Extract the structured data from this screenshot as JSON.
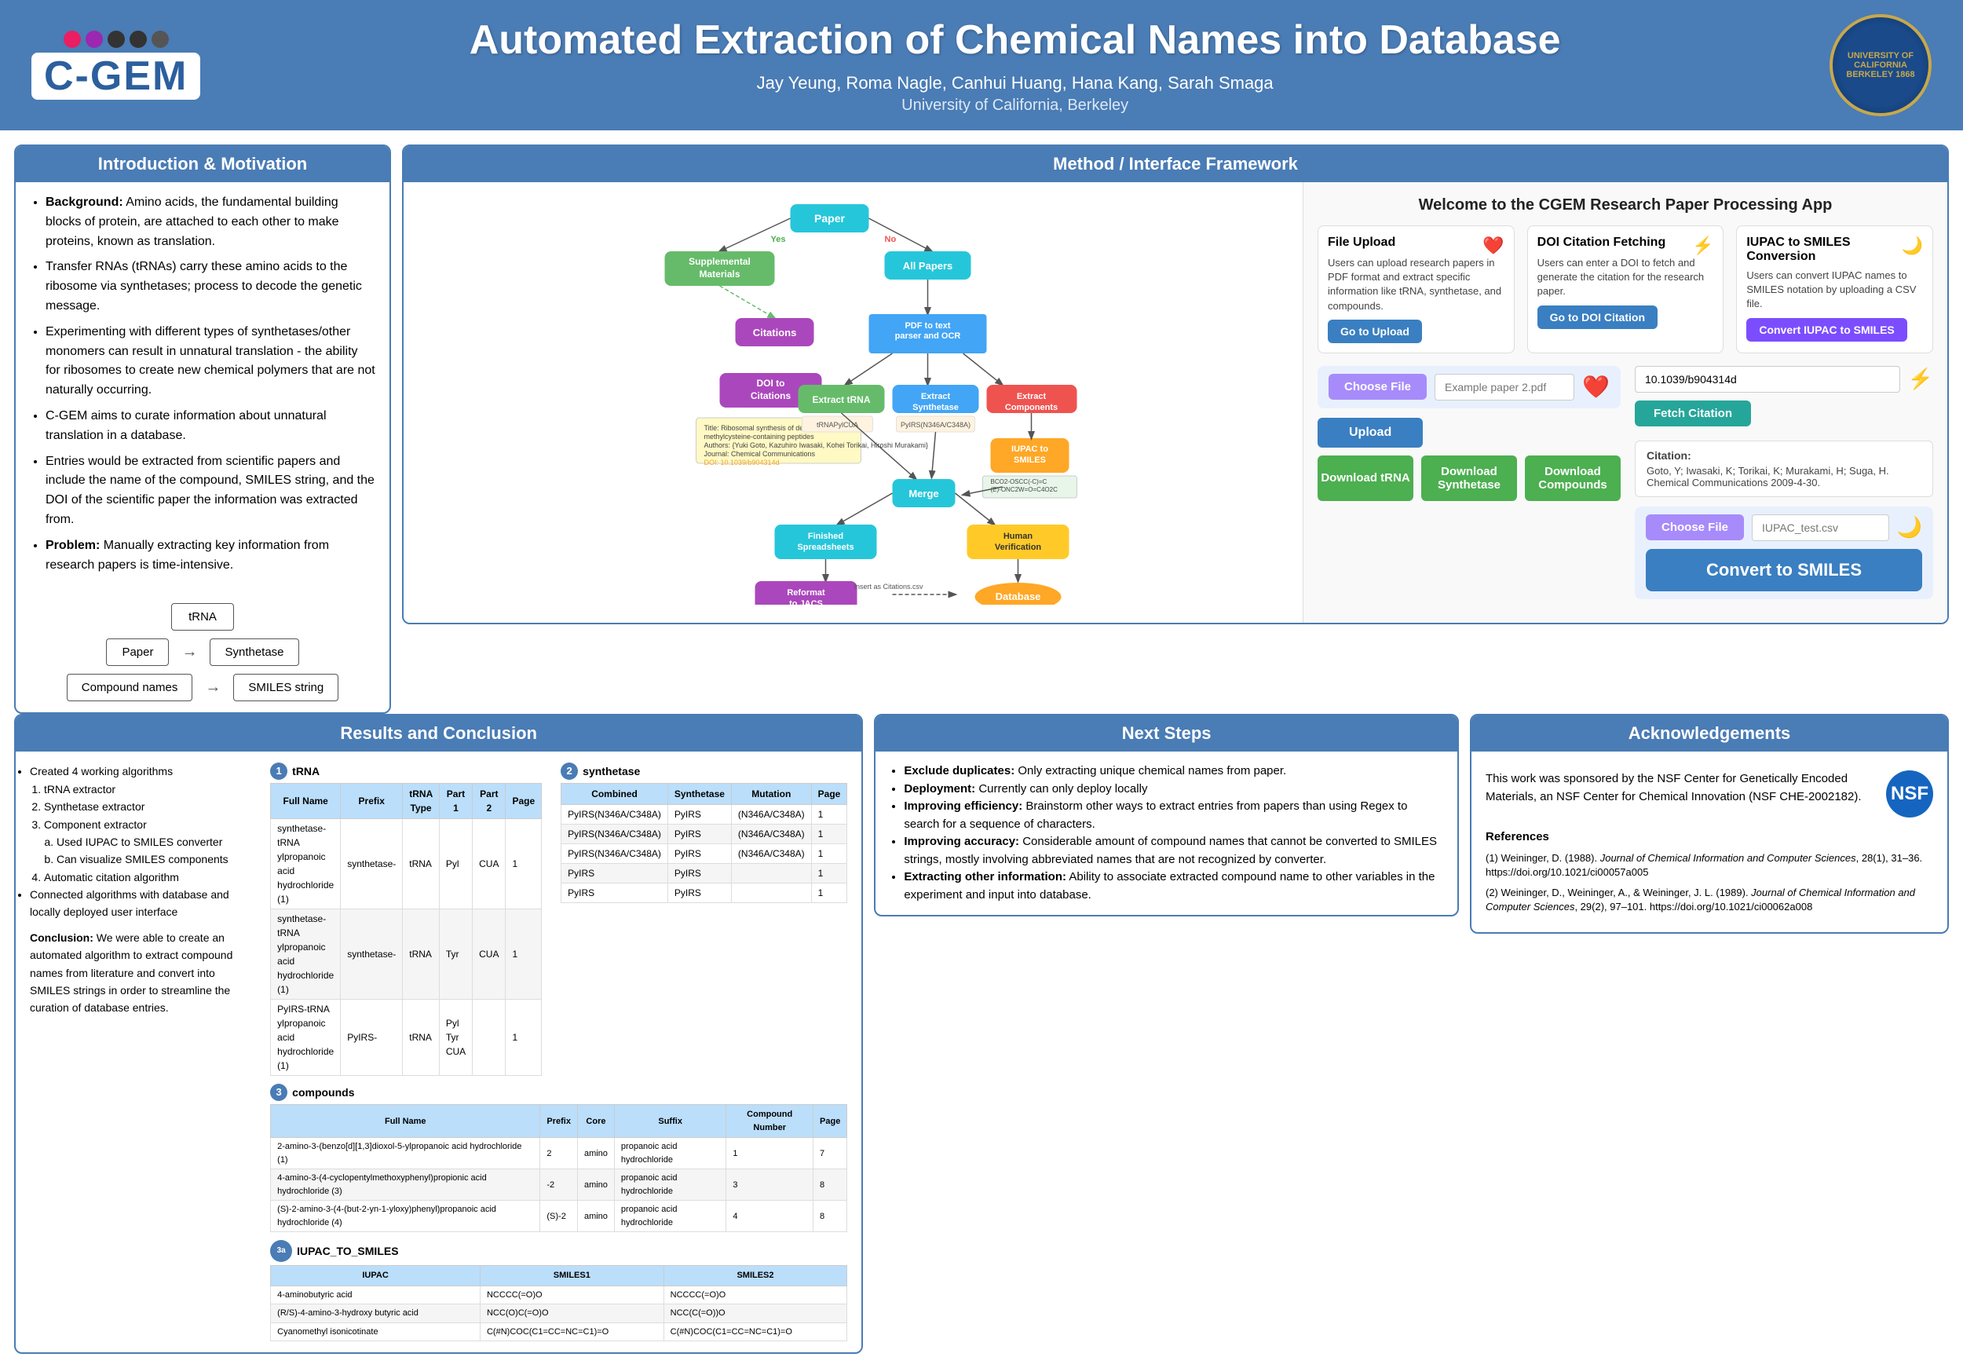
{
  "header": {
    "title": "Automated Extraction of Chemical Names into Database",
    "authors": "Jay Yeung, Roma Nagle, Canhui Huang, Hana Kang, Sarah Smaga",
    "institution": "University of California, Berkeley",
    "logo_text": "C-GEM",
    "seal_text": "UNIVERSITY OF CALIFORNIA BERKELEY 1868"
  },
  "intro": {
    "title": "Introduction & Motivation",
    "bullets": [
      {
        "bold": "Background:",
        "text": " Amino acids, the fundamental building blocks of protein, are attached to each other to make proteins, known as translation."
      },
      {
        "bold": "",
        "text": "Transfer RNAs (tRNAs) carry these amino acids to the ribosome via synthetases; process to decode the genetic message."
      },
      {
        "bold": "",
        "text": "Experimenting with different types of synthetases/other monomers can result in unnatural translation - the ability for ribosomes to create new chemical polymers that are not naturally occurring."
      },
      {
        "bold": "",
        "text": "C-GEM aims to curate information about unnatural translation in a database."
      },
      {
        "bold": "",
        "text": "Entries would be extracted from scientific papers and include the name of the compound, SMILES string, and the DOI of the scientific paper the information was extracted from."
      },
      {
        "bold": "Problem:",
        "text": " Manually extracting key information from research papers is time-intensive."
      }
    ],
    "diagram": {
      "row1": "tRNA",
      "row2_left": "Paper",
      "row2_right": "Synthetase",
      "row3_left": "Compound names",
      "row3_right": "SMILES string"
    }
  },
  "method": {
    "title": "Method / Interface Framework",
    "flowchart": {
      "nodes": [
        "Paper",
        "Supplemental Materials",
        "All Papers",
        "Citations",
        "DOI to Citations",
        "PDF to text parser and OCR",
        "Extract tRNA",
        "Extract Synthetase",
        "Extract Components",
        "IUPAC to SMILES",
        "Merge",
        "Finished Spreadsheets",
        "Human Verification",
        "Reformat to JACS",
        "Database"
      ]
    },
    "app": {
      "title": "Welcome to the CGEM Research Paper Processing App",
      "features": [
        {
          "title": "File Upload",
          "icon": "❤️",
          "desc": "Users can upload research papers in PDF format and extract specific information like tRNA, synthetase, and compounds.",
          "btn": "Go to Upload"
        },
        {
          "title": "DOI Citation Fetching",
          "icon": "⚡",
          "desc": "Users can enter a DOI to fetch and generate the citation for the research paper.",
          "btn": "Go to DOI Citation"
        },
        {
          "title": "IUPAC to SMILES Conversion",
          "icon": "🌙",
          "desc": "Users can convert IUPAC names to SMILES notation by uploading a CSV file.",
          "btn": "Convert IUPAC to SMILES"
        }
      ],
      "file_upload": {
        "choose_btn": "Choose File",
        "placeholder": "Example paper 2.pdf",
        "upload_btn": "Upload",
        "download_trna": "Download tRNA",
        "download_synthetase": "Download Synthetase",
        "download_compounds": "Download Compounds"
      },
      "doi": {
        "value": "10.1039/b904314d",
        "fetch_btn": "Fetch Citation",
        "citation_label": "Citation:",
        "citation_text": "Goto, Y; Iwasaki, K; Torikai, K; Murakami, H; Suga, H. Chemical Communications 2009-4-30."
      },
      "smiles": {
        "choose_btn": "Choose File",
        "filename": "IUPAC_test.csv",
        "convert_btn": "Convert to SMILES"
      }
    }
  },
  "results": {
    "title": "Results and Conclusion",
    "bullets": [
      "Created 4 working algorithms",
      "tRNA extractor",
      "Synthetase extractor",
      "Component extractor",
      "Used IUPAC to SMILES converter",
      "Can visualize SMILES components",
      "Automatic citation algorithm",
      "Connected algorithms with database and locally deployed user interface"
    ],
    "conclusion": {
      "title": "Conclusion:",
      "text": " We were able to create an automated algorithm to extract compound names from literature and convert into SMILES strings in order to streamline the curation of database entries."
    },
    "table1": {
      "label": "1  tRNA",
      "headers": [
        "Full Name",
        "Prefix",
        "tRNA Type",
        "Part 1",
        "Part 2",
        "Page"
      ],
      "rows": [
        [
          "synthetase-tRNA ylpropanoic acid hydrochloride (1)",
          "synthetase-",
          "tRNA",
          "Pyl",
          "CUA",
          "1"
        ],
        [
          "synthetase-tRNA ylpropanoic acid hydrochloride (1)",
          "synthetase-",
          "tRNA",
          "Tyr",
          "CUA",
          "1"
        ],
        [
          "PyIRS-tRNA ylpropanoic acid hydrochloride (1)",
          "PyIRS-",
          "tRNA",
          "Pyl\nTyr\nCUA",
          "",
          "1"
        ]
      ]
    },
    "table2": {
      "label": "2  synthetase",
      "headers": [
        "Combined",
        "Synthetase",
        "Mutation",
        "Page"
      ],
      "rows": [
        [
          "PyIRS(N346A/C348A)",
          "PyIRS",
          "(N346A/C348A)",
          "1"
        ],
        [
          "PyIRS(N346A/C348A)",
          "PyIRS",
          "(N346A/C348A)",
          "1"
        ],
        [
          "PyIRS(N346A/C348A)",
          "PyIRS",
          "(N346A/C348A)",
          "1"
        ],
        [
          "PyIRS",
          "PyIRS",
          "",
          "1"
        ],
        [
          "PyIRS",
          "PyIRS",
          "",
          "1"
        ]
      ]
    },
    "table3": {
      "label": "3  compounds",
      "headers": [
        "Full Name",
        "Prefix",
        "Core",
        "Suffix",
        "Compound Number",
        "Page"
      ],
      "rows": [
        [
          "2-amino-3-(benzo[d][1,3]dioxol-5-ylpropanoic acid hydrochloride (1)",
          "2",
          "amino",
          "propanoic acid hydrochloride",
          "1",
          "7"
        ],
        [
          "4-amino-3-(4-cyclopentylmethoxyphenyl)propionic acid hydrochloride (3)",
          "-2",
          "amino",
          "propanoic acid hydrochloride",
          "3",
          "8"
        ],
        [
          "(S)-2-amino-3-(4-(but-2-yn-1-yloxy)phenyl)propanoic acid hydrochloride (4)",
          "(S)-2",
          "amino",
          "propanoic acid hydrochloride",
          "4",
          "8"
        ]
      ]
    },
    "table3a": {
      "label": "3a  IUPAC_TO_SMILES",
      "headers": [
        "IUPAC",
        "SMILES1",
        "SMILES2"
      ],
      "rows": [
        [
          "4-aminobutyric acid",
          "NCCCC(=O)O",
          "NCCCC(=O)O"
        ],
        [
          "(R/S)-4-amino-3-hydroxy butyric acid",
          "NCC(O)C(=O)O",
          "NCC(C(=O))O"
        ],
        [
          "Cyanomethyl isonicotinate",
          "C(#N)COC(C1=CC=NC=C1)=O",
          "C(#N)COC(C1=CC=NC=C1)=O"
        ]
      ]
    }
  },
  "nextsteps": {
    "title": "Next Steps",
    "bullets": [
      {
        "bold": "Exclude duplicates:",
        "text": " Only extracting unique chemical names from paper."
      },
      {
        "bold": "Deployment:",
        "text": " Currently can only deploy locally"
      },
      {
        "bold": "Improving efficiency:",
        "text": " Brainstorm other ways to extract entries from papers than using Regex to search for a sequence of characters."
      },
      {
        "bold": "Improving accuracy:",
        "text": " Considerable amount of compound names that cannot be converted to SMILES strings, mostly involving abbreviated names that are not recognized by converter."
      },
      {
        "bold": "Extracting other information:",
        "text": " Ability to associate extracted compound name to other variables in the experiment and input into database."
      }
    ]
  },
  "acknowledgements": {
    "title": "Acknowledgements",
    "text": "This work was sponsored by the NSF Center for Genetically Encoded Materials, an NSF Center for Chemical Innovation (NSF CHE-2002182).",
    "references_title": "References",
    "references": [
      {
        "num": "(1)",
        "text": "Weininger, D. (1988). ",
        "journal": "Journal of Chemical Information and Computer Sciences",
        "rest": ", 28(1), 31–36. https://doi.org/10.1021/ci00057a005"
      },
      {
        "num": "(2)",
        "text": "Weininger, D., Weininger, A., & Weininger, J. L. (1989). ",
        "journal": "Journal of Chemical Information and Computer Sciences",
        "rest": ", 29(2), 97–101. https://doi.org/10.1021/ci00062a008"
      }
    ],
    "nsf_label": "NSF"
  }
}
